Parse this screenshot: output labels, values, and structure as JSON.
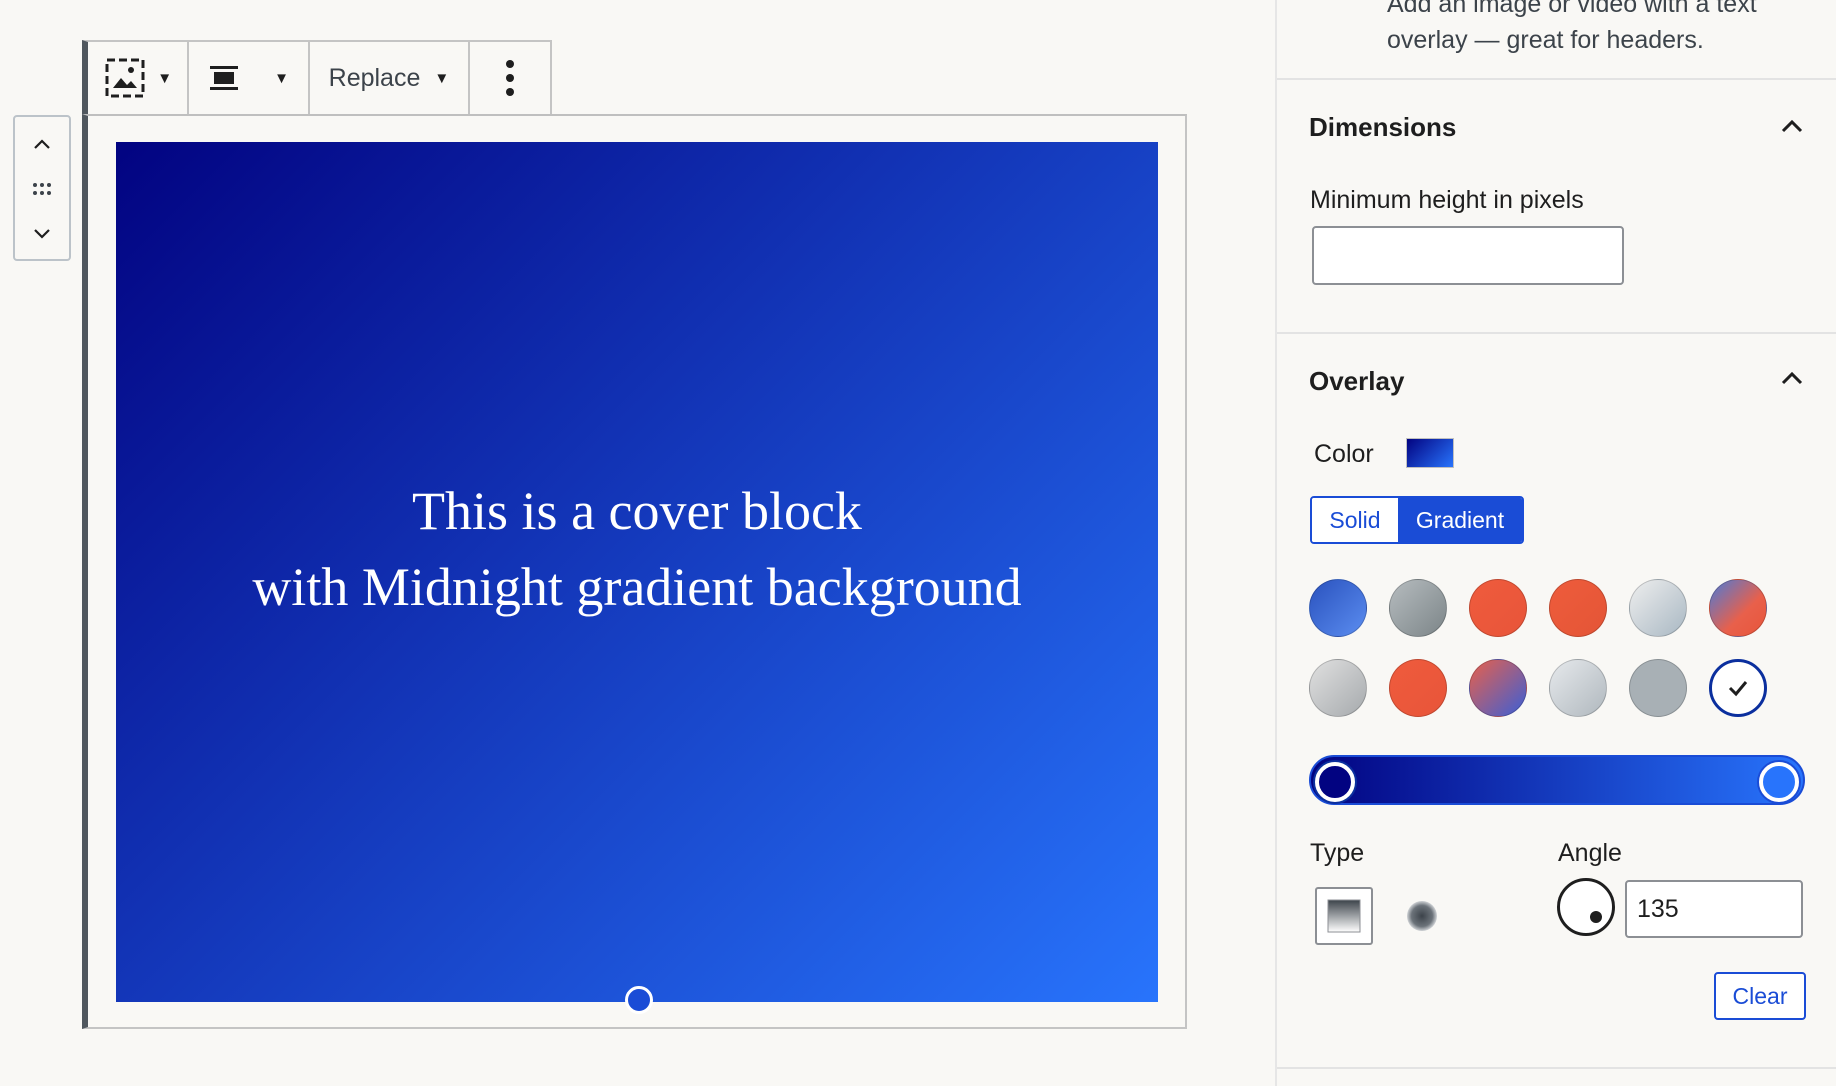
{
  "toolbar": {
    "media_icon": "cover-image-icon",
    "align_icon": "align-center-icon",
    "replace_label": "Replace",
    "more_icon": "more-vertical-icon"
  },
  "mover": {
    "up_icon": "chevron-up-icon",
    "drag_icon": "drag-handle-icon",
    "down_icon": "chevron-down-icon"
  },
  "cover": {
    "line1": "This is a cover block",
    "line2": "with Midnight gradient background",
    "gradient_start": "#020381",
    "gradient_end": "#2874fc"
  },
  "sidebar": {
    "intro_line1": "Add an image or video with a text",
    "intro_line2": "overlay — great for headers.",
    "dimensions": {
      "title": "Dimensions",
      "min_height_label": "Minimum height in pixels",
      "min_height_value": ""
    },
    "overlay": {
      "title": "Overlay",
      "color_label": "Color",
      "tab_solid": "Solid",
      "tab_gradient": "Gradient",
      "presets": [
        {
          "name": "Vivid cyan blue to vivid purple",
          "css": "linear-gradient(135deg,#2a52be,#5b8df0)"
        },
        {
          "name": "Light green cyan to vivid green cyan",
          "css": "linear-gradient(135deg,#b6bcbf,#7c8588)"
        },
        {
          "name": "Luminous vivid amber to luminous vivid orange",
          "css": "linear-gradient(135deg,#ef5b3c,#e8553a)"
        },
        {
          "name": "Luminous vivid orange to vivid red",
          "css": "linear-gradient(135deg,#ee5c3c,#e45536)"
        },
        {
          "name": "Very light gray to cyan bluish gray",
          "css": "linear-gradient(135deg,#eeeeee,#a9b8c3)"
        },
        {
          "name": "Cool to warm spectrum",
          "css": "linear-gradient(135deg,#4a7bd9,#e8604b 60%,#e8553a)"
        },
        {
          "name": "Blush light purple",
          "css": "linear-gradient(135deg,#e0e0e0,#a6aaad)"
        },
        {
          "name": "Blush bordeaux",
          "css": "linear-gradient(135deg,#ef5b3c,#e8553a)"
        },
        {
          "name": "Luminous dusk",
          "css": "linear-gradient(135deg,#e8604b,#3b5fd6)"
        },
        {
          "name": "Pale ocean",
          "css": "linear-gradient(135deg,#e6e9ec,#b0b8be)"
        },
        {
          "name": "Electric grass",
          "css": "linear-gradient(135deg,#a8b0b5,#a8b0b5)"
        },
        {
          "name": "Midnight",
          "css": "linear-gradient(135deg,#020381,#2874fc)"
        }
      ],
      "selected_preset": "Midnight",
      "type_label": "Type",
      "type_linear_icon": "linear-gradient-icon",
      "type_radial_icon": "radial-gradient-icon",
      "angle_label": "Angle",
      "angle_value": "135",
      "clear_label": "Clear"
    }
  },
  "colors": {
    "accent": "#1a4cd6",
    "dark_accent": "#0b2f9e",
    "text": "#1e1e1e",
    "muted_text": "#3c434a"
  }
}
